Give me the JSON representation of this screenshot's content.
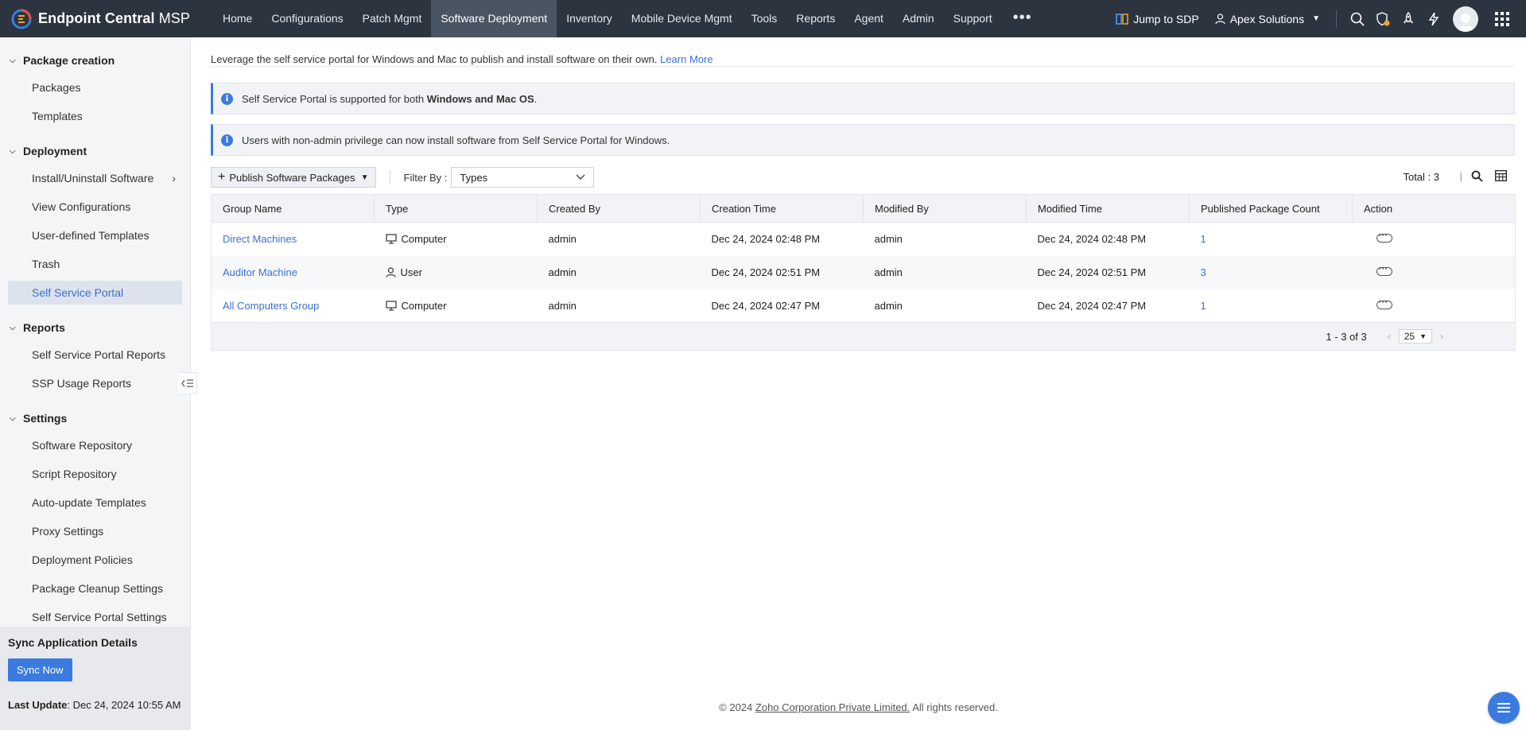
{
  "brand": {
    "name": "Endpoint Central",
    "suffix": "MSP"
  },
  "nav": {
    "items": [
      {
        "label": "Home"
      },
      {
        "label": "Configurations"
      },
      {
        "label": "Patch Mgmt"
      },
      {
        "label": "Software Deployment",
        "active": true
      },
      {
        "label": "Inventory"
      },
      {
        "label": "Mobile Device Mgmt"
      },
      {
        "label": "Tools"
      },
      {
        "label": "Reports"
      },
      {
        "label": "Agent"
      },
      {
        "label": "Admin"
      },
      {
        "label": "Support"
      }
    ],
    "more": "•••",
    "jump_label": "Jump to SDP",
    "org_label": "Apex Solutions"
  },
  "sidebar": {
    "sections": [
      {
        "title": "Package creation",
        "items": [
          "Packages",
          "Templates"
        ]
      },
      {
        "title": "Deployment",
        "items": [
          "Install/Uninstall Software",
          "View Configurations",
          "User-defined Templates",
          "Trash",
          "Self Service Portal"
        ]
      },
      {
        "title": "Reports",
        "items": [
          "Self Service Portal Reports",
          "SSP Usage Reports"
        ]
      },
      {
        "title": "Settings",
        "items": [
          "Software Repository",
          "Script Repository",
          "Auto-update Templates",
          "Proxy Settings",
          "Deployment Policies",
          "Package Cleanup Settings",
          "Self Service Portal Settings"
        ]
      }
    ],
    "sync": {
      "title": "Sync Application Details",
      "button": "Sync Now",
      "last_update_label": "Last Update",
      "last_update_value": ": Dec 24, 2024 10:55 AM"
    }
  },
  "main": {
    "intro_text": "Leverage the self service portal for Windows and Mac to publish and install software on their own.",
    "learn_more": "Learn More",
    "banner1_text": "Self Service Portal is supported for both",
    "banner1_bold": "Windows and Mac OS",
    "banner1_end": ".",
    "banner2_text": "Users with non-admin privilege can now install software from Self Service Portal for Windows.",
    "publish_button": "Publish Software Packages",
    "filter_label": "Filter By :",
    "filter_value": "Types",
    "total": "Total : 3",
    "columns": [
      "Group Name",
      "Type",
      "Created By",
      "Creation Time",
      "Modified By",
      "Modified Time",
      "Published Package Count",
      "Action"
    ],
    "rows": [
      {
        "group": "Direct Machines",
        "type": "Computer",
        "type_icon": "monitor-icon",
        "created_by": "admin",
        "creation_time": "Dec 24, 2024 02:48 PM",
        "modified_by": "admin",
        "modified_time": "Dec 24, 2024 02:48 PM",
        "count": "1"
      },
      {
        "group": "Auditor Machine",
        "type": "User",
        "type_icon": "user-icon",
        "created_by": "admin",
        "creation_time": "Dec 24, 2024 02:51 PM",
        "modified_by": "admin",
        "modified_time": "Dec 24, 2024 02:51 PM",
        "count": "3"
      },
      {
        "group": "All Computers Group",
        "type": "Computer",
        "type_icon": "monitor-icon",
        "created_by": "admin",
        "creation_time": "Dec 24, 2024 02:47 PM",
        "modified_by": "admin",
        "modified_time": "Dec 24, 2024 02:47 PM",
        "count": "1"
      }
    ],
    "pager_range": "1 - 3 of 3",
    "per_page": "25"
  },
  "footer": {
    "prefix": "© 2024",
    "company": "Zoho Corporation Private Limited.",
    "suffix": "All rights reserved."
  },
  "colors": {
    "topbar": "#2c3440",
    "accent": "#3b7be0",
    "link": "#3b6fd4"
  }
}
